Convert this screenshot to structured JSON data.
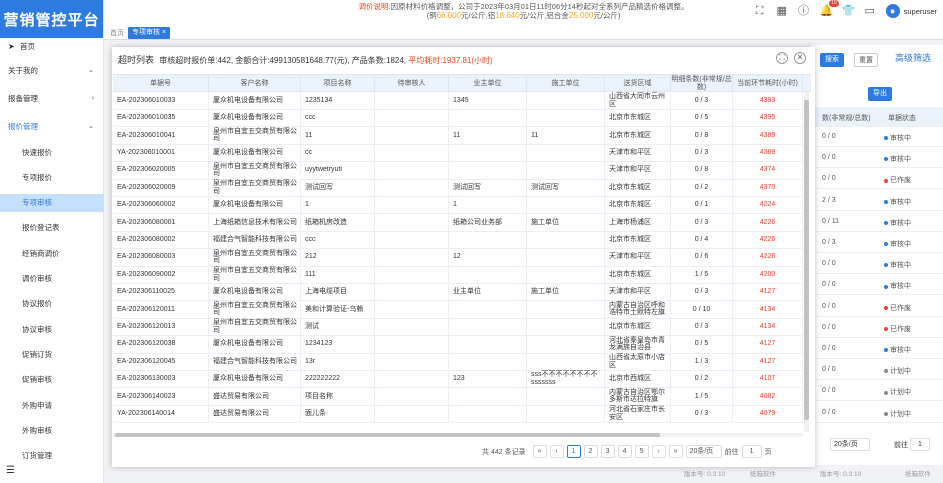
{
  "app": {
    "title": "营销管控平台"
  },
  "header": {
    "notice_line1_prefix": "调价说明:",
    "notice_line1_text": "因原材料价格调整，公司于2023年03月01日11时06分14秒起对全系列产品精选价格调整。",
    "notice_line2_a": "(铜",
    "copper_price": "66.000",
    "notice_line2_b": "元/公斤,铝",
    "aluminum_price": "18.640",
    "notice_line2_c": "元/公斤,铝合金",
    "alloy_price": "25.000",
    "notice_line2_d": "元/公斤)",
    "notification_count": "10",
    "username": "superuser"
  },
  "colors": {
    "brand": "#2d7ae0",
    "highlight": "#e64a19",
    "alert": "#f04134",
    "price": "#f5a623"
  },
  "tabs": {
    "home": "首页",
    "active": "专项审核 ×"
  },
  "sidebar": {
    "items": [
      {
        "label": "首页",
        "type": "top",
        "icon": "send-icon"
      },
      {
        "label": "关于我的",
        "type": "top",
        "chevron": "⌄"
      },
      {
        "label": "报备管理",
        "type": "top",
        "chevron": "›"
      },
      {
        "label": "报价管理",
        "type": "top",
        "chevron": "⌄",
        "highlight": true
      },
      {
        "label": "快速报价",
        "type": "sub"
      },
      {
        "label": "专项报价",
        "type": "sub"
      },
      {
        "label": "专项审核",
        "type": "sub",
        "active": true
      },
      {
        "label": "报价登记表",
        "type": "sub"
      },
      {
        "label": "经销商调价",
        "type": "sub"
      },
      {
        "label": "调价审核",
        "type": "sub"
      },
      {
        "label": "协议报价",
        "type": "sub"
      },
      {
        "label": "协议审核",
        "type": "sub"
      },
      {
        "label": "促销订货",
        "type": "sub"
      },
      {
        "label": "促销审核",
        "type": "sub"
      },
      {
        "label": "外购申请",
        "type": "sub"
      },
      {
        "label": "外购审核",
        "type": "sub"
      },
      {
        "label": "订货管理",
        "type": "sub"
      }
    ]
  },
  "background": {
    "buttons": {
      "search": "搜索",
      "reset": "重置",
      "advanced": "高级筛选",
      "export": "导出"
    },
    "col_count_header": "数(非常规/总数)",
    "col_status_header": "单据状态",
    "rows": [
      {
        "count": "0 / 0",
        "status": "审核中",
        "dot": "#2d7ae0"
      },
      {
        "count": "0 / 0",
        "status": "审核中",
        "dot": "#2d7ae0"
      },
      {
        "count": "0 / 0",
        "status": "已作废",
        "dot": "#f04134"
      },
      {
        "count": "2 / 3",
        "status": "审核中",
        "dot": "#2d7ae0"
      },
      {
        "count": "0 / 11",
        "status": "审核中",
        "dot": "#2d7ae0"
      },
      {
        "count": "0 / 3",
        "status": "审核中",
        "dot": "#2d7ae0"
      },
      {
        "count": "0 / 0",
        "status": "审核中",
        "dot": "#2d7ae0"
      },
      {
        "count": "0 / 0",
        "status": "审核中",
        "dot": "#2d7ae0"
      },
      {
        "count": "0 / 0",
        "status": "已作废",
        "dot": "#f04134"
      },
      {
        "count": "0 / 0",
        "status": "已作废",
        "dot": "#f04134"
      },
      {
        "count": "0 / 0",
        "status": "审核中",
        "dot": "#2d7ae0"
      },
      {
        "count": "0 / 0",
        "status": "计划中",
        "dot": "#888888"
      },
      {
        "count": "0 / 0",
        "status": "计划中",
        "dot": "#888888"
      },
      {
        "count": "0 / 0",
        "status": "计划中",
        "dot": "#888888"
      }
    ],
    "page_size": "20条/页",
    "goto_label": "前往",
    "goto_value": "1",
    "footer_version": "版本号: 0.3.10",
    "footer_company": "纸箱软件"
  },
  "modal": {
    "title_label": "超时列表",
    "summary_text": "审核超时报价单:442, 金额合计:499130581648.77(元), 产品条数:1824,",
    "avg_text": "平均耗时:1937.81(小时)",
    "columns": [
      "单据号",
      "客户名称",
      "项目名称",
      "待审核人",
      "业主单位",
      "施工单位",
      "送货区域",
      "明细条数(非常规/总数)",
      "当前环节耗时(小时)"
    ],
    "rows": [
      [
        "EA-202306010033",
        "厦众机电设备有限公司",
        "1235134",
        "",
        "1345",
        "",
        "山西省大同市云州区",
        "0 / 3",
        "4393"
      ],
      [
        "EA-202306010035",
        "厦众机电设备有限公司",
        "ccc",
        "",
        "",
        "",
        "北京市东城区",
        "0 / 5",
        "4395"
      ],
      [
        "EA-202306010041",
        "泉州市自宜五交商贸有限公司",
        "11",
        "",
        "11",
        "11",
        "北京市东城区",
        "0 / 8",
        "4389"
      ],
      [
        "YA-202306010001",
        "厦众机电设备有限公司",
        "cc",
        "",
        "",
        "",
        "天津市和平区",
        "0 / 3",
        "4369"
      ],
      [
        "EA-202306020005",
        "泉州市自宜五交商贸有限公司",
        "uyytwetryuti",
        "",
        "",
        "",
        "天津市和平区",
        "0 / 8",
        "4374"
      ],
      [
        "EA-202306020009",
        "泉州市自宜五交商贸有限公司",
        "测试回写",
        "",
        "测试回写",
        "测试回写",
        "北京市东城区",
        "0 / 2",
        "4370"
      ],
      [
        "EA-202306060002",
        "厦众机电设备有限公司",
        "1",
        "",
        "1",
        "",
        "北京市东城区",
        "0 / 1",
        "4224"
      ],
      [
        "EA-202306080001",
        "上海纸箱信息技术有限公司",
        "纸箱机房改造",
        "",
        "纸箱公司业务部",
        "施工单位",
        "上海市杨浦区",
        "0 / 3",
        "4226"
      ],
      [
        "EA-202306080002",
        "福建合气智能科技有限公司",
        "ccc",
        "",
        "",
        "",
        "北京市东城区",
        "0 / 4",
        "4226"
      ],
      [
        "EA-202306080003",
        "泉州市自宜五交商贸有限公司",
        "212",
        "",
        "12",
        "",
        "天津市和平区",
        "0 / 6",
        "4226"
      ],
      [
        "EA-202306090002",
        "泉州市自宜五交商贸有限公司",
        "111",
        "",
        "",
        "",
        "北京市东城区",
        "1 / 5",
        "4200"
      ],
      [
        "EA-202306110025",
        "厦众机电设备有限公司",
        "上海电缆项目",
        "",
        "业主单位",
        "施工单位",
        "天津市和平区",
        "0 / 3",
        "4127"
      ],
      [
        "EA-202306120011",
        "泉州市自宜五交商贸有限公司",
        "美和计算验证-乌赖",
        "",
        "",
        "",
        "内蒙古自治区呼和浩特市土默特左旗",
        "0 / 10",
        "4134"
      ],
      [
        "EA-202306120013",
        "泉州市自宜五交商贸有限公司",
        "测试",
        "",
        "",
        "",
        "北京市东城区",
        "0 / 3",
        "4134"
      ],
      [
        "EA-202306120038",
        "厦众机电设备有限公司",
        "1234123",
        "",
        "",
        "",
        "河北省秦皇岛市青龙满族自治县",
        "0 / 5",
        "4127"
      ],
      [
        "EA-202306120045",
        "福建合气智能科技有限公司",
        "13r",
        "",
        "",
        "",
        "山西省太原市小店区",
        "1 / 3",
        "4127"
      ],
      [
        "EA-202306130003",
        "厦众机电设备有限公司",
        "222222222",
        "",
        "123",
        "sss不不不不不不不不sssssss",
        "北京市西城区",
        "0 / 2",
        "4107"
      ],
      [
        "EA-202306140023",
        "盛达贸易有限公司",
        "项目名称",
        "",
        "",
        "",
        "内蒙古自治区鄂尔多斯市达拉特旗",
        "1 / 5",
        "4082"
      ],
      [
        "YA-202306140014",
        "盛达贸易有限公司",
        "面儿条",
        "",
        "",
        "",
        "河北省石家庄市长安区",
        "0 / 3",
        "4079"
      ]
    ],
    "pager": {
      "total": "共 442 条记录",
      "pages": [
        "1",
        "2",
        "3",
        "4",
        "5"
      ],
      "current": "1",
      "page_size": "20条/页",
      "goto_label": "前往",
      "goto_value": "1",
      "page_suffix": "页"
    }
  },
  "footer": {
    "version": "版本号: 0.3.10",
    "company": "纸箱软件"
  }
}
